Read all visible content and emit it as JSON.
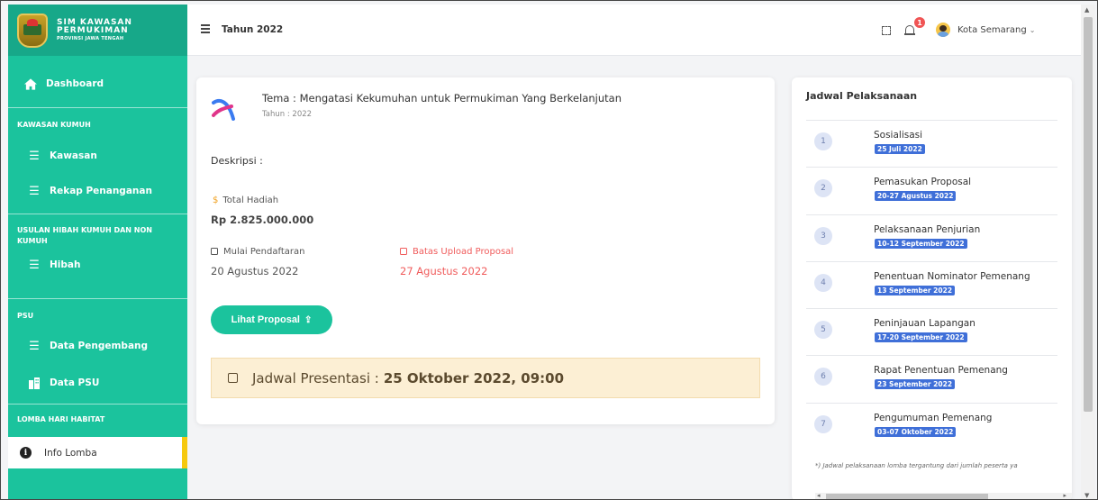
{
  "brand": {
    "line1": "SIM KAWASAN",
    "line2": "PERMUKIMAN",
    "line3": "PROVINSI JAWA TENGAH",
    "color": "#1bc39d"
  },
  "sidebar": {
    "dashboard": "Dashboard",
    "section_kawasan": "KAWASAN KUMUH",
    "kawasan": "Kawasan",
    "rekap": "Rekap Penanganan",
    "section_usulan": "USULAN HIBAH KUMUH DAN NON KUMUH",
    "hibah": "Hibah",
    "section_psu": "PSU",
    "data_pengembang": "Data Pengembang",
    "data_psu": "Data PSU",
    "section_lomba": "LOMBA HARI HABITAT",
    "info_lomba": "Info Lomba"
  },
  "topbar": {
    "year": "Tahun 2022",
    "notification_count": "1",
    "user": "Kota Semarang"
  },
  "main": {
    "theme": "Tema : Mengatasi Kekumuhan untuk Permukiman Yang Berkelanjutan",
    "theme_year": "Tahun : 2022",
    "description_label": "Deskripsi :",
    "prize_label": "Total Hadiah",
    "prize_value": "Rp 2.825.000.000",
    "registration_label": "Mulai Pendaftaran",
    "registration_value": "20 Agustus 2022",
    "upload_label": "Batas Upload Proposal",
    "upload_value": "27 Agustus 2022",
    "button_label": "Lihat Proposal",
    "presentation_label": "Jadwal Presentasi :",
    "presentation_value": "25 Oktober 2022, 09:00"
  },
  "schedule": {
    "title": "Jadwal Pelaksanaan",
    "items": [
      {
        "num": "1",
        "name": "Sosialisasi",
        "date": "25 Juli 2022"
      },
      {
        "num": "2",
        "name": "Pemasukan Proposal",
        "date": "20-27 Agustus 2022"
      },
      {
        "num": "3",
        "name": "Pelaksanaan Penjurian",
        "date": "10-12 September 2022"
      },
      {
        "num": "4",
        "name": "Penentuan Nominator Pemenang",
        "date": "13 September 2022"
      },
      {
        "num": "5",
        "name": "Peninjauan Lapangan",
        "date": "17-20 September 2022"
      },
      {
        "num": "6",
        "name": "Rapat Penentuan Pemenang",
        "date": "23 September 2022"
      },
      {
        "num": "7",
        "name": "Pengumuman Pemenang",
        "date": "03-07 Oktober 2022"
      }
    ],
    "note": "*) Jadwal pelaksanaan lomba tergantung dari jumlah peserta ya"
  }
}
